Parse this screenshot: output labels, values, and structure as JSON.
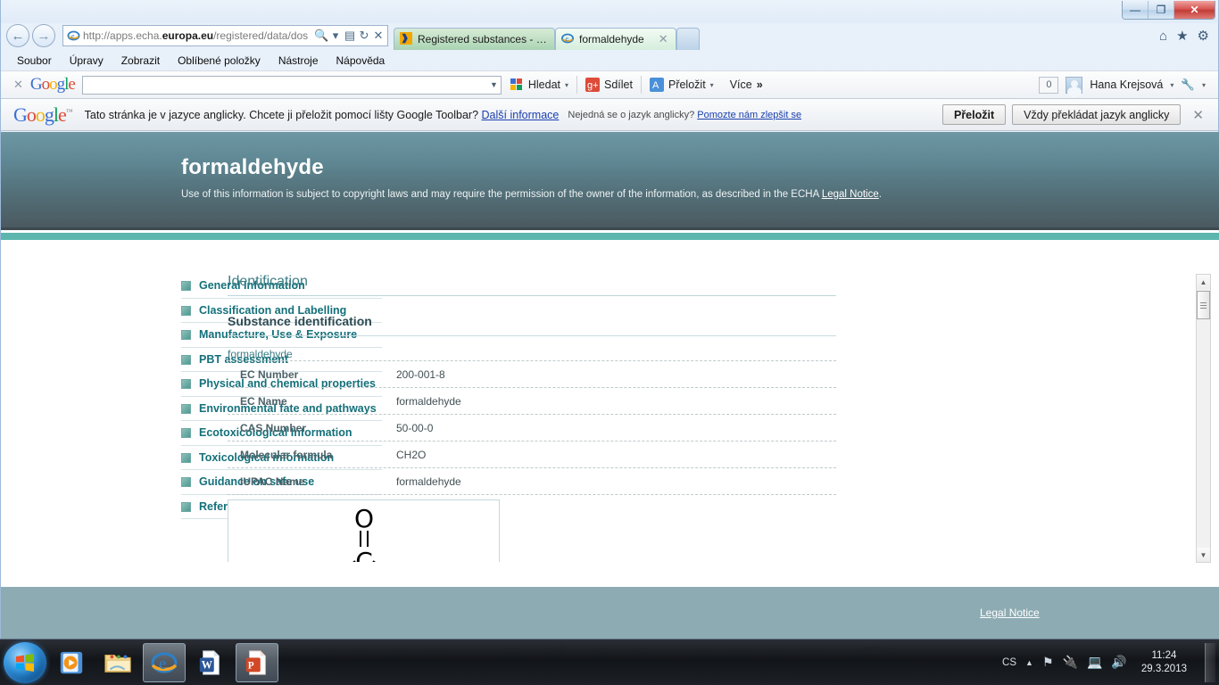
{
  "window": {
    "minimize": "—",
    "maximize": "❐",
    "close": "✕"
  },
  "browser": {
    "back_icon": "←",
    "forward_icon": "→",
    "address_prefix": "http://apps.echa.",
    "address_bold": "europa.eu",
    "address_suffix": "/registered/data/dos",
    "search_icon": "search-icon",
    "dropdown_icon": "▾",
    "compat_icon": "compatibility-view-icon",
    "refresh_icon": "↻",
    "stop_icon": "✕",
    "tabs": [
      {
        "title": "Registered substances - ECHA",
        "active": false,
        "favicon": "echa-favicon"
      },
      {
        "title": "formaldehyde",
        "active": true,
        "favicon": "ie-favicon",
        "close": "✕"
      }
    ],
    "new_tab_label": "",
    "tool_icons": [
      "home-icon",
      "favorites-icon",
      "settings-icon"
    ]
  },
  "menubar": {
    "items": [
      "Soubor",
      "Úpravy",
      "Zobrazit",
      "Oblíbené položky",
      "Nástroje",
      "Nápověda"
    ]
  },
  "google_toolbar": {
    "close_label": "✕",
    "logo": "Google",
    "search_value": "",
    "items": [
      {
        "label": "Hledat",
        "icon": "google-search-icon",
        "caret": "▾"
      },
      {
        "label": "Sdílet",
        "icon": "google-plus-share-icon",
        "caret": ""
      },
      {
        "label": "Přeložit",
        "icon": "translate-icon",
        "caret": "▾"
      },
      {
        "label": "Více",
        "icon": "",
        "caret": "»"
      }
    ],
    "notification_count": "0",
    "account_name": "Hana Krejsová",
    "account_caret": "▾",
    "wrench_icon": "wrench-icon",
    "wrench_caret": "▾"
  },
  "translate_bar": {
    "logo": "Google",
    "logo_tm": "™",
    "message": "Tato stránka je v jazyce anglicky. Chcete ji přeložit pomocí lišty Google Toolbar?",
    "learn_more": "Další informace",
    "not_english": "Nejedná se o jazyk anglicky?",
    "help_improve": "Pomozte nám zlepšit se",
    "translate_button": "Přeložit",
    "always_button": "Vždy překládat jazyk anglicky",
    "close_icon": "✕"
  },
  "page": {
    "title": "formaldehyde",
    "copyright_before": "Use of this information is subject to copyright laws and may require the permission of the owner of the information, as described in the ECHA ",
    "copyright_link": "Legal Notice",
    "copyright_after": ".",
    "sidebar": [
      {
        "label": "General Information"
      },
      {
        "label": "Classification and Labelling"
      },
      {
        "label": "Manufacture, Use & Exposure"
      },
      {
        "label": "PBT assessment"
      },
      {
        "label": "Physical and chemical properties"
      },
      {
        "label": "Environmental fate and pathways"
      },
      {
        "label": "Ecotoxicological Information"
      },
      {
        "label": "Toxicological information"
      },
      {
        "label": "Guidance on safe use"
      },
      {
        "label": "Reference substances"
      }
    ],
    "main_title": "Identification",
    "section_title": "Substance identification",
    "substance_name": "formaldehyde",
    "identification_rows": [
      {
        "key": "EC Number",
        "value": "200-001-8"
      },
      {
        "key": "EC Name",
        "value": "formaldehyde"
      },
      {
        "key": "CAS Number",
        "value": "50-00-0"
      },
      {
        "key": "Molecular formula",
        "value": "CH2O"
      },
      {
        "key": "IUPAC Name",
        "value": "formaldehyde"
      }
    ],
    "structure": {
      "atom_top": "O",
      "atom_bottom": "C",
      "bond": "double"
    },
    "footer_link": "Legal Notice",
    "scrollbar": {
      "up": "▲",
      "down": "▼"
    }
  },
  "taskbar": {
    "start_icon": "windows-start-icon",
    "items": [
      {
        "icon": "media-player-icon",
        "open": false
      },
      {
        "icon": "file-explorer-icon",
        "open": false
      },
      {
        "icon": "internet-explorer-icon",
        "open": true
      },
      {
        "icon": "word-document-icon",
        "open": false
      },
      {
        "icon": "powerpoint-document-icon",
        "open": true
      }
    ],
    "language": "CS",
    "tray_expand": "▲",
    "tray_icons": [
      "flag-action-center-icon",
      "power-icon",
      "network-icon",
      "volume-icon"
    ],
    "clock_time": "11:24",
    "clock_date": "29.3.2013"
  },
  "colors": {
    "accent_teal": "#5cb6ae",
    "header_top": "#6d97a3",
    "header_bottom": "#4b5960",
    "link_teal": "#14707a",
    "footer": "#8dabb2"
  }
}
